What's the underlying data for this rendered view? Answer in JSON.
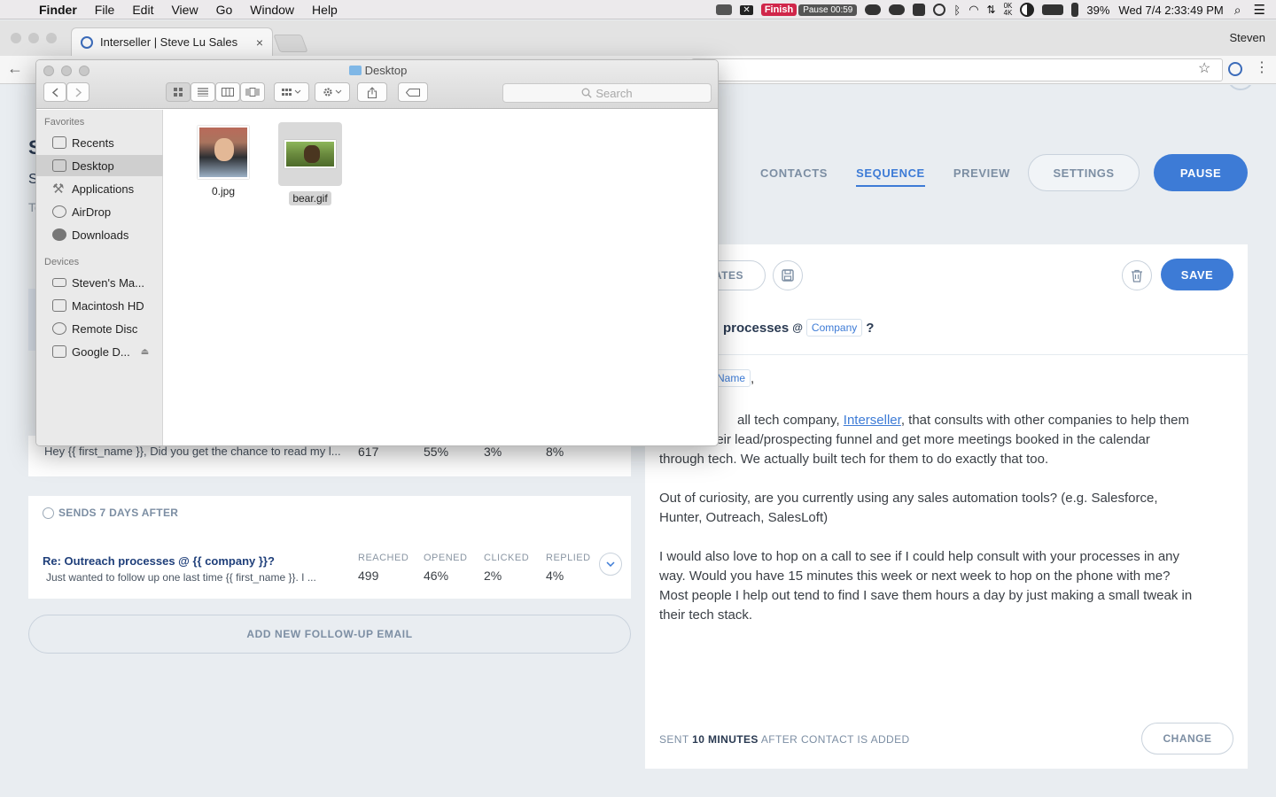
{
  "menubar": {
    "app": "Finder",
    "items": [
      "File",
      "Edit",
      "View",
      "Go",
      "Window",
      "Help"
    ],
    "finish_label": "Finish",
    "pause_label": "Pause 00:59",
    "x_label": "✕",
    "net_up": "0K",
    "net_down": "4K",
    "battery": "39%",
    "datetime": "Wed 7/4  2:33:49 PM"
  },
  "browser": {
    "tab_title": "Interseller | Steve Lu Sales",
    "profile_name": "Steven"
  },
  "app": {
    "left_title_fragment": "S",
    "left_subtitle_fragment": "S",
    "left_small_fragment": "To",
    "nav_tabs": [
      "CONTACTS",
      "SEQUENCE",
      "PREVIEW"
    ],
    "active_tab": "SEQUENCE",
    "settings_label": "SETTINGS",
    "pause_label": "PAUSE"
  },
  "editor": {
    "templates_label": "ATES",
    "save_label": "SAVE",
    "subject_text": "processes",
    "subject_at": "@",
    "subject_chip": "Company",
    "subject_end": "?",
    "greeting_chip": "Name",
    "greeting_comma": ",",
    "body_line1_pre": "all tech company, ",
    "body_link": "Interseller",
    "body_line1_post": ", that consults with other companies to help them",
    "body_line2": "heir lead/prospecting funnel and get more meetings booked in the calendar",
    "body_line3": "through tech. We actually built tech for them to do exactly that too.",
    "body_p2": "Out of curiosity, are you currently using any sales automation tools? (e.g. Salesforce,\nHunter, Outreach, SalesLoft)",
    "body_p3": "I would also love to hop on a call to see if I could help consult with your processes in any\nway. Would you have 15 minutes this week or next week to hop on the phone with me?\nMost people I help out tend to find I save them hours a day by just making a small tweak in\ntheir tech stack.",
    "sent_prefix": "SENT",
    "sent_bold": "10 MINUTES",
    "sent_suffix": "AFTER CONTACT IS ADDED",
    "change_label": "CHANGE"
  },
  "sequence": {
    "email1": {
      "preview": "Hey {{ first_name }}, Did you get the chance to read my l...",
      "reached": "617",
      "opened": "55%",
      "clicked": "3%",
      "replied": "8%"
    },
    "email2": {
      "delay": "SENDS 7 DAYS AFTER",
      "subject": "Re: Outreach processes @ {{ company }}?",
      "preview": "Just wanted to follow up one last time {{ first_name }}. I ...",
      "labels": [
        "REACHED",
        "OPENED",
        "CLICKED",
        "REPLIED"
      ],
      "reached": "499",
      "opened": "46%",
      "clicked": "2%",
      "replied": "4%"
    },
    "add_followup_label": "ADD NEW FOLLOW-UP EMAIL"
  },
  "finder": {
    "title": "Desktop",
    "search_placeholder": "Search",
    "favorites_heading": "Favorites",
    "favorites": [
      "Recents",
      "Desktop",
      "Applications",
      "AirDrop",
      "Downloads"
    ],
    "selected_sidebar": "Desktop",
    "devices_heading": "Devices",
    "devices": [
      "Steven's Ma...",
      "Macintosh HD",
      "Remote Disc",
      "Google D..."
    ],
    "files": [
      {
        "name": "0.jpg"
      },
      {
        "name": "bear.gif",
        "selected": true
      }
    ]
  }
}
